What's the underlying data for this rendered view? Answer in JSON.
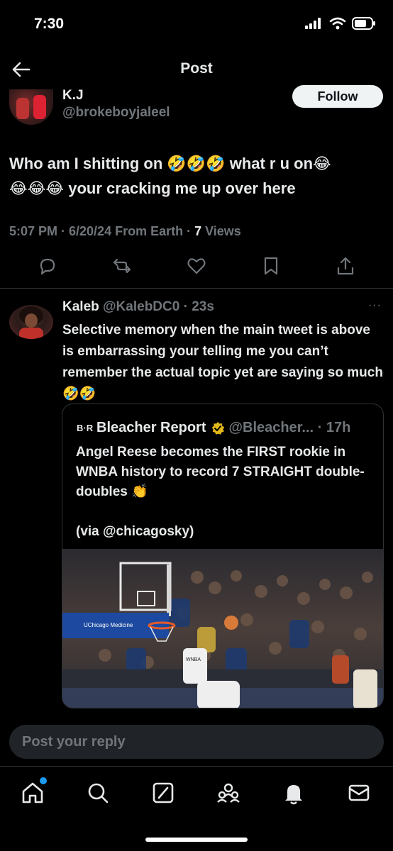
{
  "status_bar": {
    "time": "7:30"
  },
  "header": {
    "title": "Post"
  },
  "main_post": {
    "display_name": "K.J",
    "handle": "@brokeboyjaleel",
    "follow_label": "Follow",
    "text_line1": "Who am I shitting on 🤣🤣🤣 what r u on😂",
    "text_line2": "😂😂😂 your cracking me up over here",
    "meta_time": "5:07 PM · 6/20/24 From Earth · ",
    "views_count": "7",
    "views_label": " Views"
  },
  "reply": {
    "display_name": "Kaleb",
    "handle": "@KalebDC0 · 23s",
    "more": "···",
    "text": "Selective memory when the main tweet is above is embarrassing your telling me you can’t remember the actual topic yet are saying so much 🤣🤣",
    "quote": {
      "logo": "B·R",
      "name": "Bleacher Report",
      "handle": "@Bleacher... · 17h",
      "text": "Angel Reese becomes the FIRST rookie in WNBA history to record 7 STRAIGHT double-doubles 👏",
      "via": "(via @chicagosky)",
      "media_signs": {
        "court": "UChicago Medicine",
        "shirt": "WNBA"
      }
    }
  },
  "reply_bar": {
    "placeholder": "Post your reply"
  },
  "icons": {
    "back": "arrow-left-icon",
    "reply": "reply-icon",
    "repost": "repost-icon",
    "like": "heart-icon",
    "bookmark": "bookmark-icon",
    "share": "share-icon",
    "home": "home-icon",
    "search": "search-icon",
    "grok": "grok-icon",
    "communities": "communities-icon",
    "notifications": "bell-icon",
    "messages": "mail-icon"
  },
  "colors": {
    "accent": "#1d9bf0",
    "background": "#000000",
    "muted": "#71767b",
    "text": "#e7e9ea",
    "follow_bg": "#eff3f4"
  }
}
